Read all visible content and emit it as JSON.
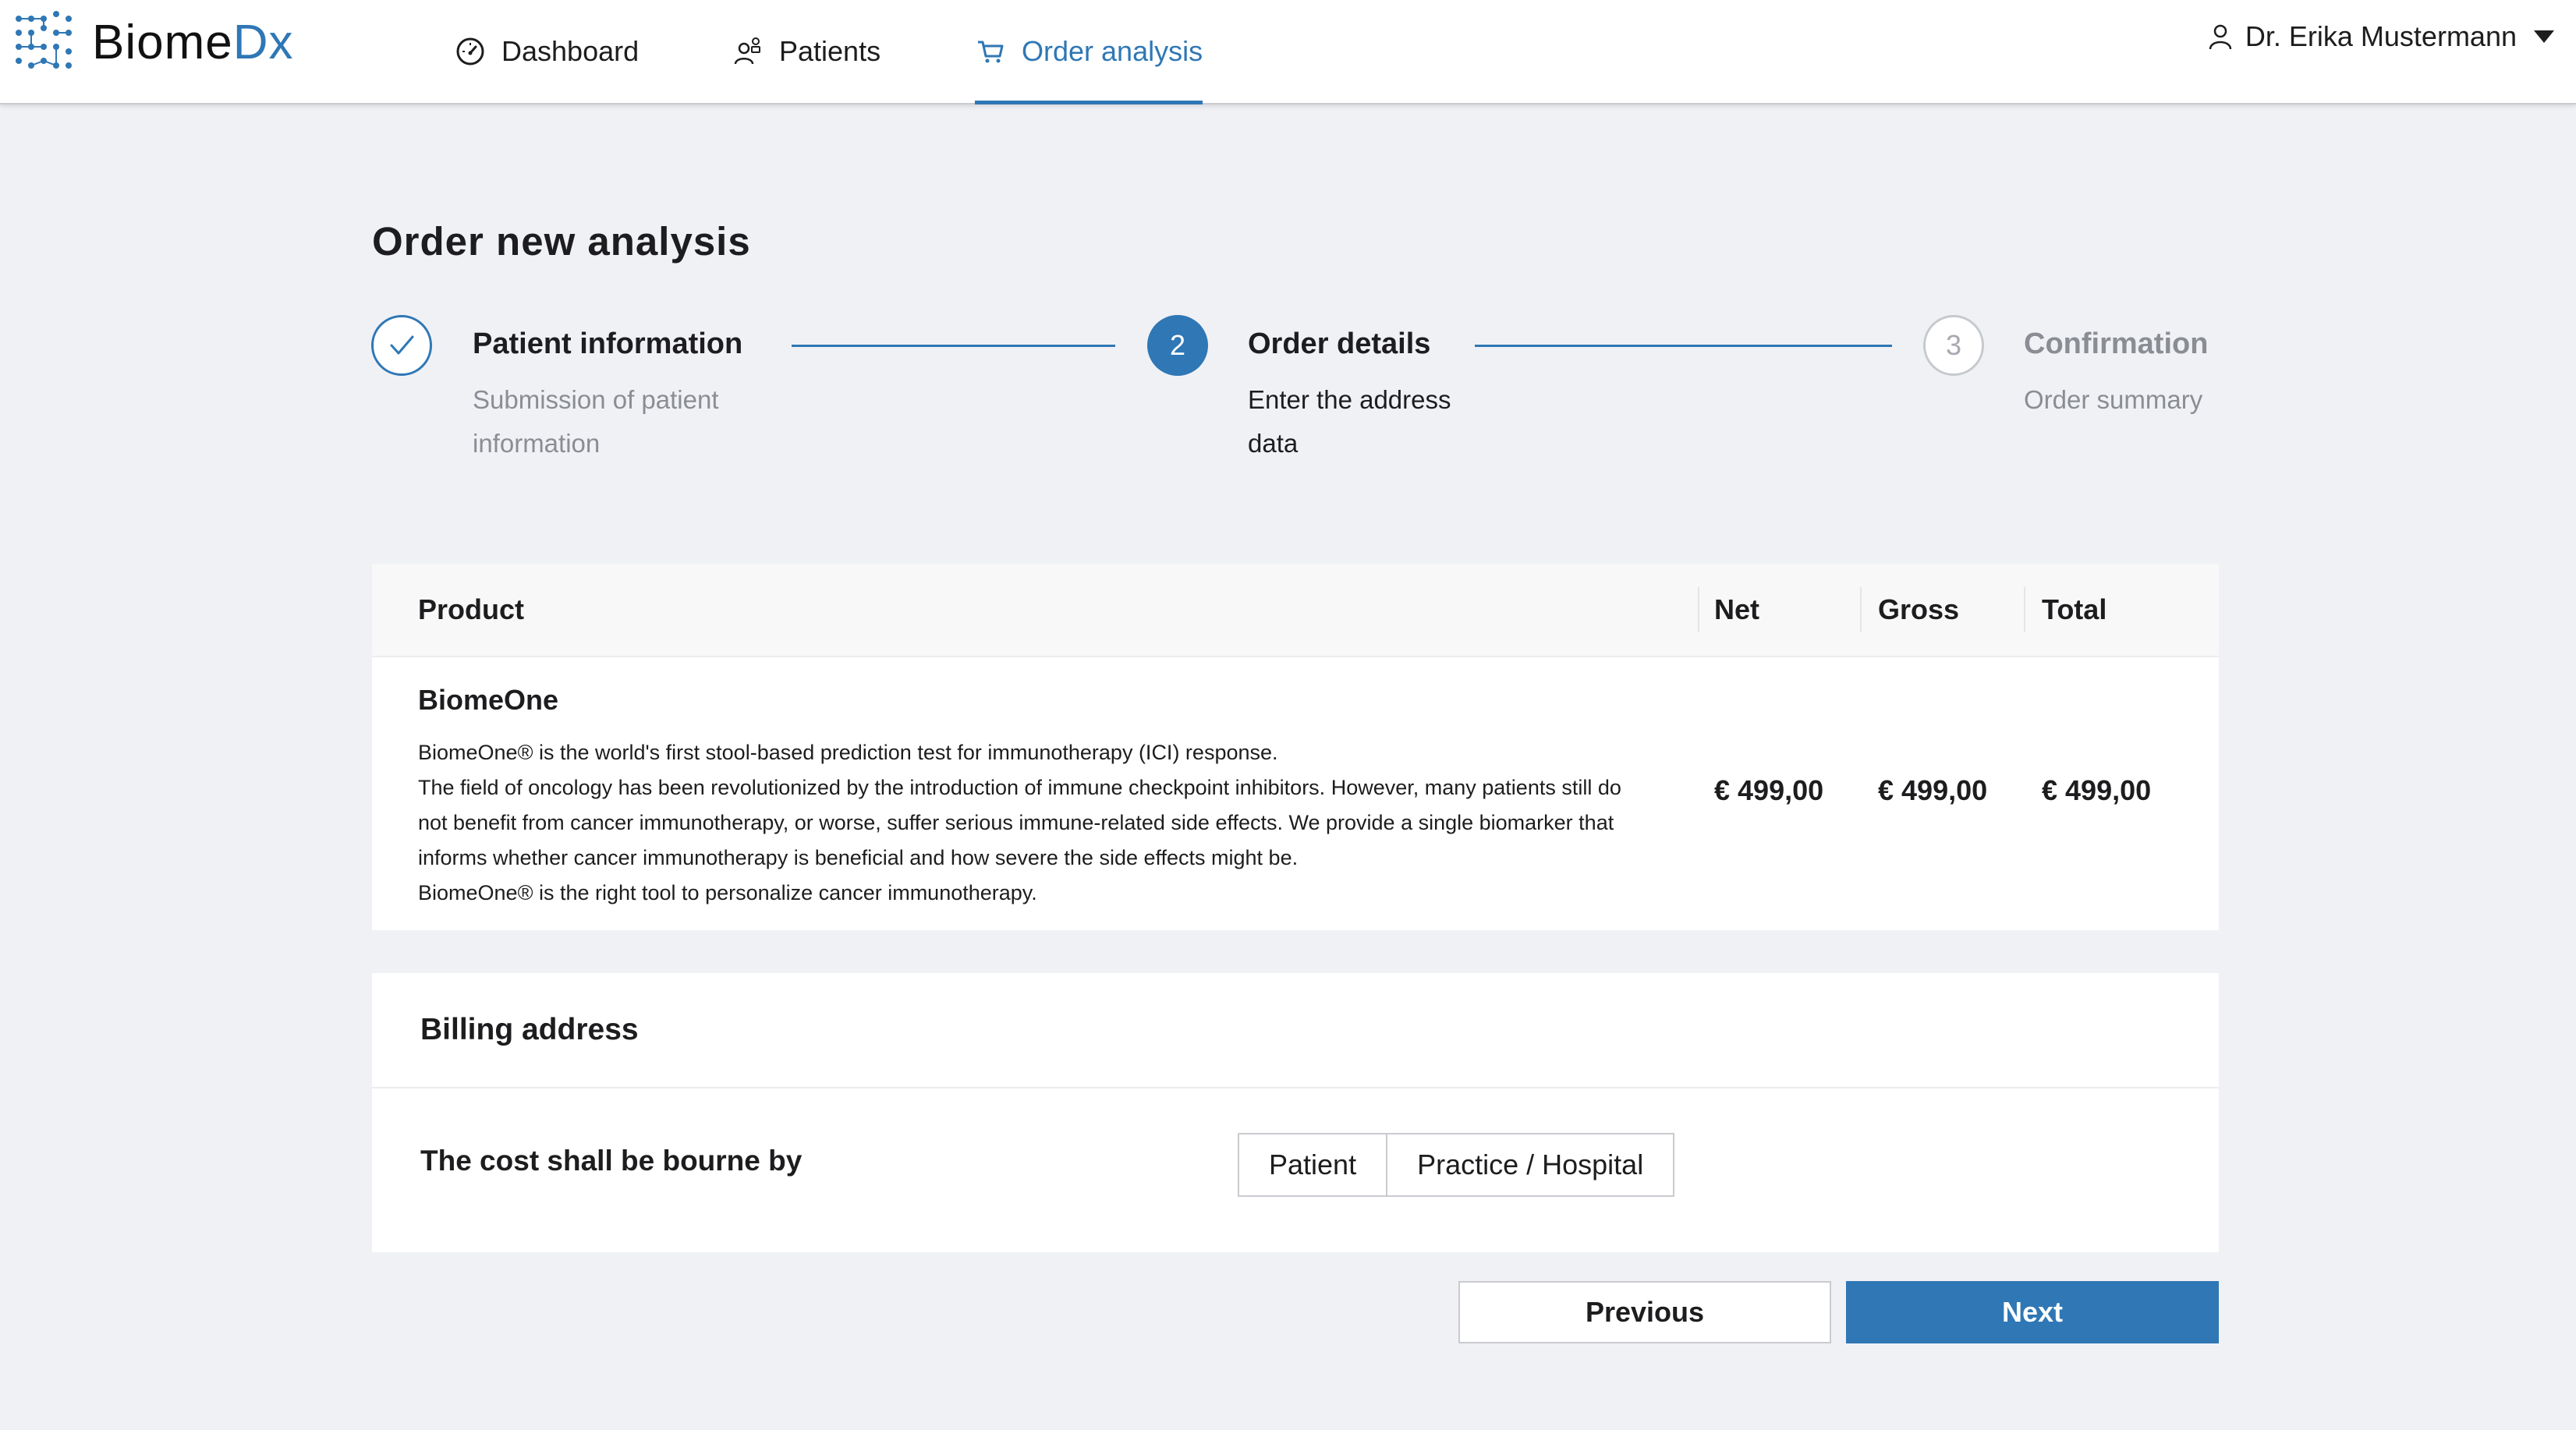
{
  "brand": {
    "name_part1": "Biome",
    "name_part2": "Dx",
    "accent_color": "#2f77b5"
  },
  "nav": {
    "items": [
      {
        "label": "Dashboard",
        "icon": "speedometer-icon",
        "active": false
      },
      {
        "label": "Patients",
        "icon": "patients-icon",
        "active": false
      },
      {
        "label": "Order analysis",
        "icon": "cart-icon",
        "active": true
      }
    ],
    "user": {
      "name": "Dr. Erika Mustermann",
      "icon": "user-icon"
    }
  },
  "page": {
    "title": "Order new analysis"
  },
  "stepper": {
    "steps": [
      {
        "status": "done",
        "marker": "",
        "title": "Patient information",
        "subtitle_line1": "Submission of patient",
        "subtitle_line2": "information"
      },
      {
        "status": "current",
        "marker": "2",
        "title": "Order details",
        "subtitle_line1": "Enter the address",
        "subtitle_line2": "data"
      },
      {
        "status": "todo",
        "marker": "3",
        "title": "Confirmation",
        "subtitle_line1": "Order summary",
        "subtitle_line2": ""
      }
    ]
  },
  "product_table": {
    "headers": {
      "product": "Product",
      "net": "Net",
      "gross": "Gross",
      "total": "Total"
    },
    "rows": [
      {
        "name": "BiomeOne",
        "description": [
          "BiomeOne® is the world's first stool-based prediction test for immunotherapy (ICI) response.",
          "The field of oncology has been revolutionized by the introduction of immune checkpoint inhibitors. However, many patients still do not benefit from cancer immunotherapy, or worse, suffer serious immune-related side effects. We provide a single biomarker that informs whether cancer immunotherapy is beneficial and how severe the side effects might be.",
          "BiomeOne® is the right tool to personalize cancer immunotherapy."
        ],
        "net": "€ 499,00",
        "gross": "€ 499,00",
        "total": "€ 499,00"
      }
    ]
  },
  "billing": {
    "title": "Billing address",
    "cost_label": "The cost shall be bourne by",
    "options": [
      "Patient",
      "Practice / Hospital"
    ]
  },
  "actions": {
    "previous": "Previous",
    "next": "Next"
  }
}
